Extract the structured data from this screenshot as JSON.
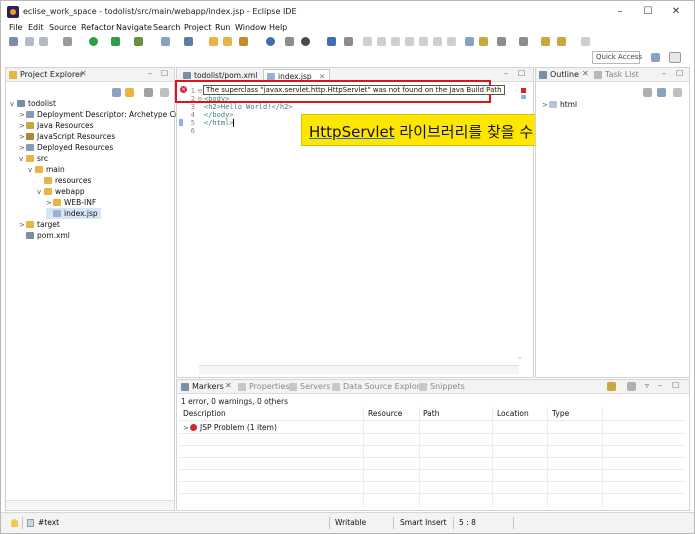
{
  "window": {
    "title": "eclise_work_space - todolist/src/main/webapp/index.jsp - Eclipse IDE",
    "minimize": "–",
    "maximize": "☐",
    "close": "✕"
  },
  "menubar": [
    "File",
    "Edit",
    "Source",
    "Refactor",
    "Navigate",
    "Search",
    "Project",
    "Run",
    "Window",
    "Help"
  ],
  "toolbar": {
    "quick_access_placeholder": "Quick Access"
  },
  "project_explorer": {
    "title": "Project Explorer",
    "close_glyph": "✕",
    "min_glyph": "–",
    "max_glyph": "☐",
    "tree": [
      {
        "label": "todolist",
        "twist": "v",
        "icon": "project-icon",
        "level": 0
      },
      {
        "label": "Deployment Descriptor: Archetype Crea",
        "twist": ">",
        "icon": "descriptor-icon",
        "level": 1
      },
      {
        "label": "Java Resources",
        "twist": ">",
        "icon": "java-resources-icon",
        "level": 1
      },
      {
        "label": "JavaScript Resources",
        "twist": ">",
        "icon": "js-resources-icon",
        "level": 1
      },
      {
        "label": "Deployed Resources",
        "twist": ">",
        "icon": "deployed-icon",
        "level": 1
      },
      {
        "label": "src",
        "twist": "v",
        "icon": "folder-icon",
        "level": 1
      },
      {
        "label": "main",
        "twist": "v",
        "icon": "folder-icon",
        "level": 2
      },
      {
        "label": "resources",
        "twist": "",
        "icon": "folder-icon",
        "level": 3
      },
      {
        "label": "webapp",
        "twist": "v",
        "icon": "folder-icon",
        "level": 3
      },
      {
        "label": "WEB-INF",
        "twist": ">",
        "icon": "folder-icon",
        "level": 4
      },
      {
        "label": "index.jsp",
        "twist": "",
        "icon": "jsp-file-icon",
        "level": 4,
        "selected": true
      },
      {
        "label": "target",
        "twist": ">",
        "icon": "folder-icon",
        "level": 1
      },
      {
        "label": "pom.xml",
        "twist": "",
        "icon": "xml-file-icon",
        "level": 1
      }
    ]
  },
  "editor": {
    "tabs": [
      {
        "label": "todolist/pom.xml",
        "active": false
      },
      {
        "label": "index.jsp",
        "active": true,
        "close": "✕"
      }
    ],
    "lines": [
      {
        "num": "1",
        "fold": "⊖",
        "text": "<html>"
      },
      {
        "num": "2",
        "fold": "⊖",
        "text": "<body>"
      },
      {
        "num": "3",
        "fold": "",
        "text": "<h2>Hello World!</h2>"
      },
      {
        "num": "4",
        "fold": "",
        "text": "</body>"
      },
      {
        "num": "5",
        "fold": "",
        "text": "</html>"
      },
      {
        "num": "6",
        "fold": "",
        "text": ""
      }
    ],
    "error_tooltip": "The superclass \"javax.servlet.http.HttpServlet\" was not found on the Java Build Path",
    "callout": {
      "highlight": "HttpServlet",
      "rest": " 라이브러리를 찾을 수 없다는 오류 입니다."
    }
  },
  "outline": {
    "title": "Outline",
    "second_tab": "Task List",
    "items": [
      {
        "label": "html",
        "twist": ">"
      }
    ]
  },
  "markers": {
    "tabs": [
      {
        "label": "Markers",
        "active": true
      },
      {
        "label": "Properties",
        "active": false
      },
      {
        "label": "Servers",
        "active": false
      },
      {
        "label": "Data Source Explorer",
        "active": false
      },
      {
        "label": "Snippets",
        "active": false
      }
    ],
    "summary": "1 error, 0 warnings, 0 others",
    "columns": [
      "Description",
      "Resource",
      "Path",
      "Location",
      "Type"
    ],
    "rows": [
      {
        "description": "JSP Problem (1 item)",
        "twist": ">"
      }
    ]
  },
  "statusbar": {
    "path": "#text",
    "writable": "Writable",
    "insert_mode": "Smart Insert",
    "position": "5 : 8"
  },
  "colors": {
    "error_red": "#e0121a",
    "callout_yellow": "#ffe600",
    "folder_yellow": "#e8b444",
    "selection_blue": "#d6e6f7"
  }
}
